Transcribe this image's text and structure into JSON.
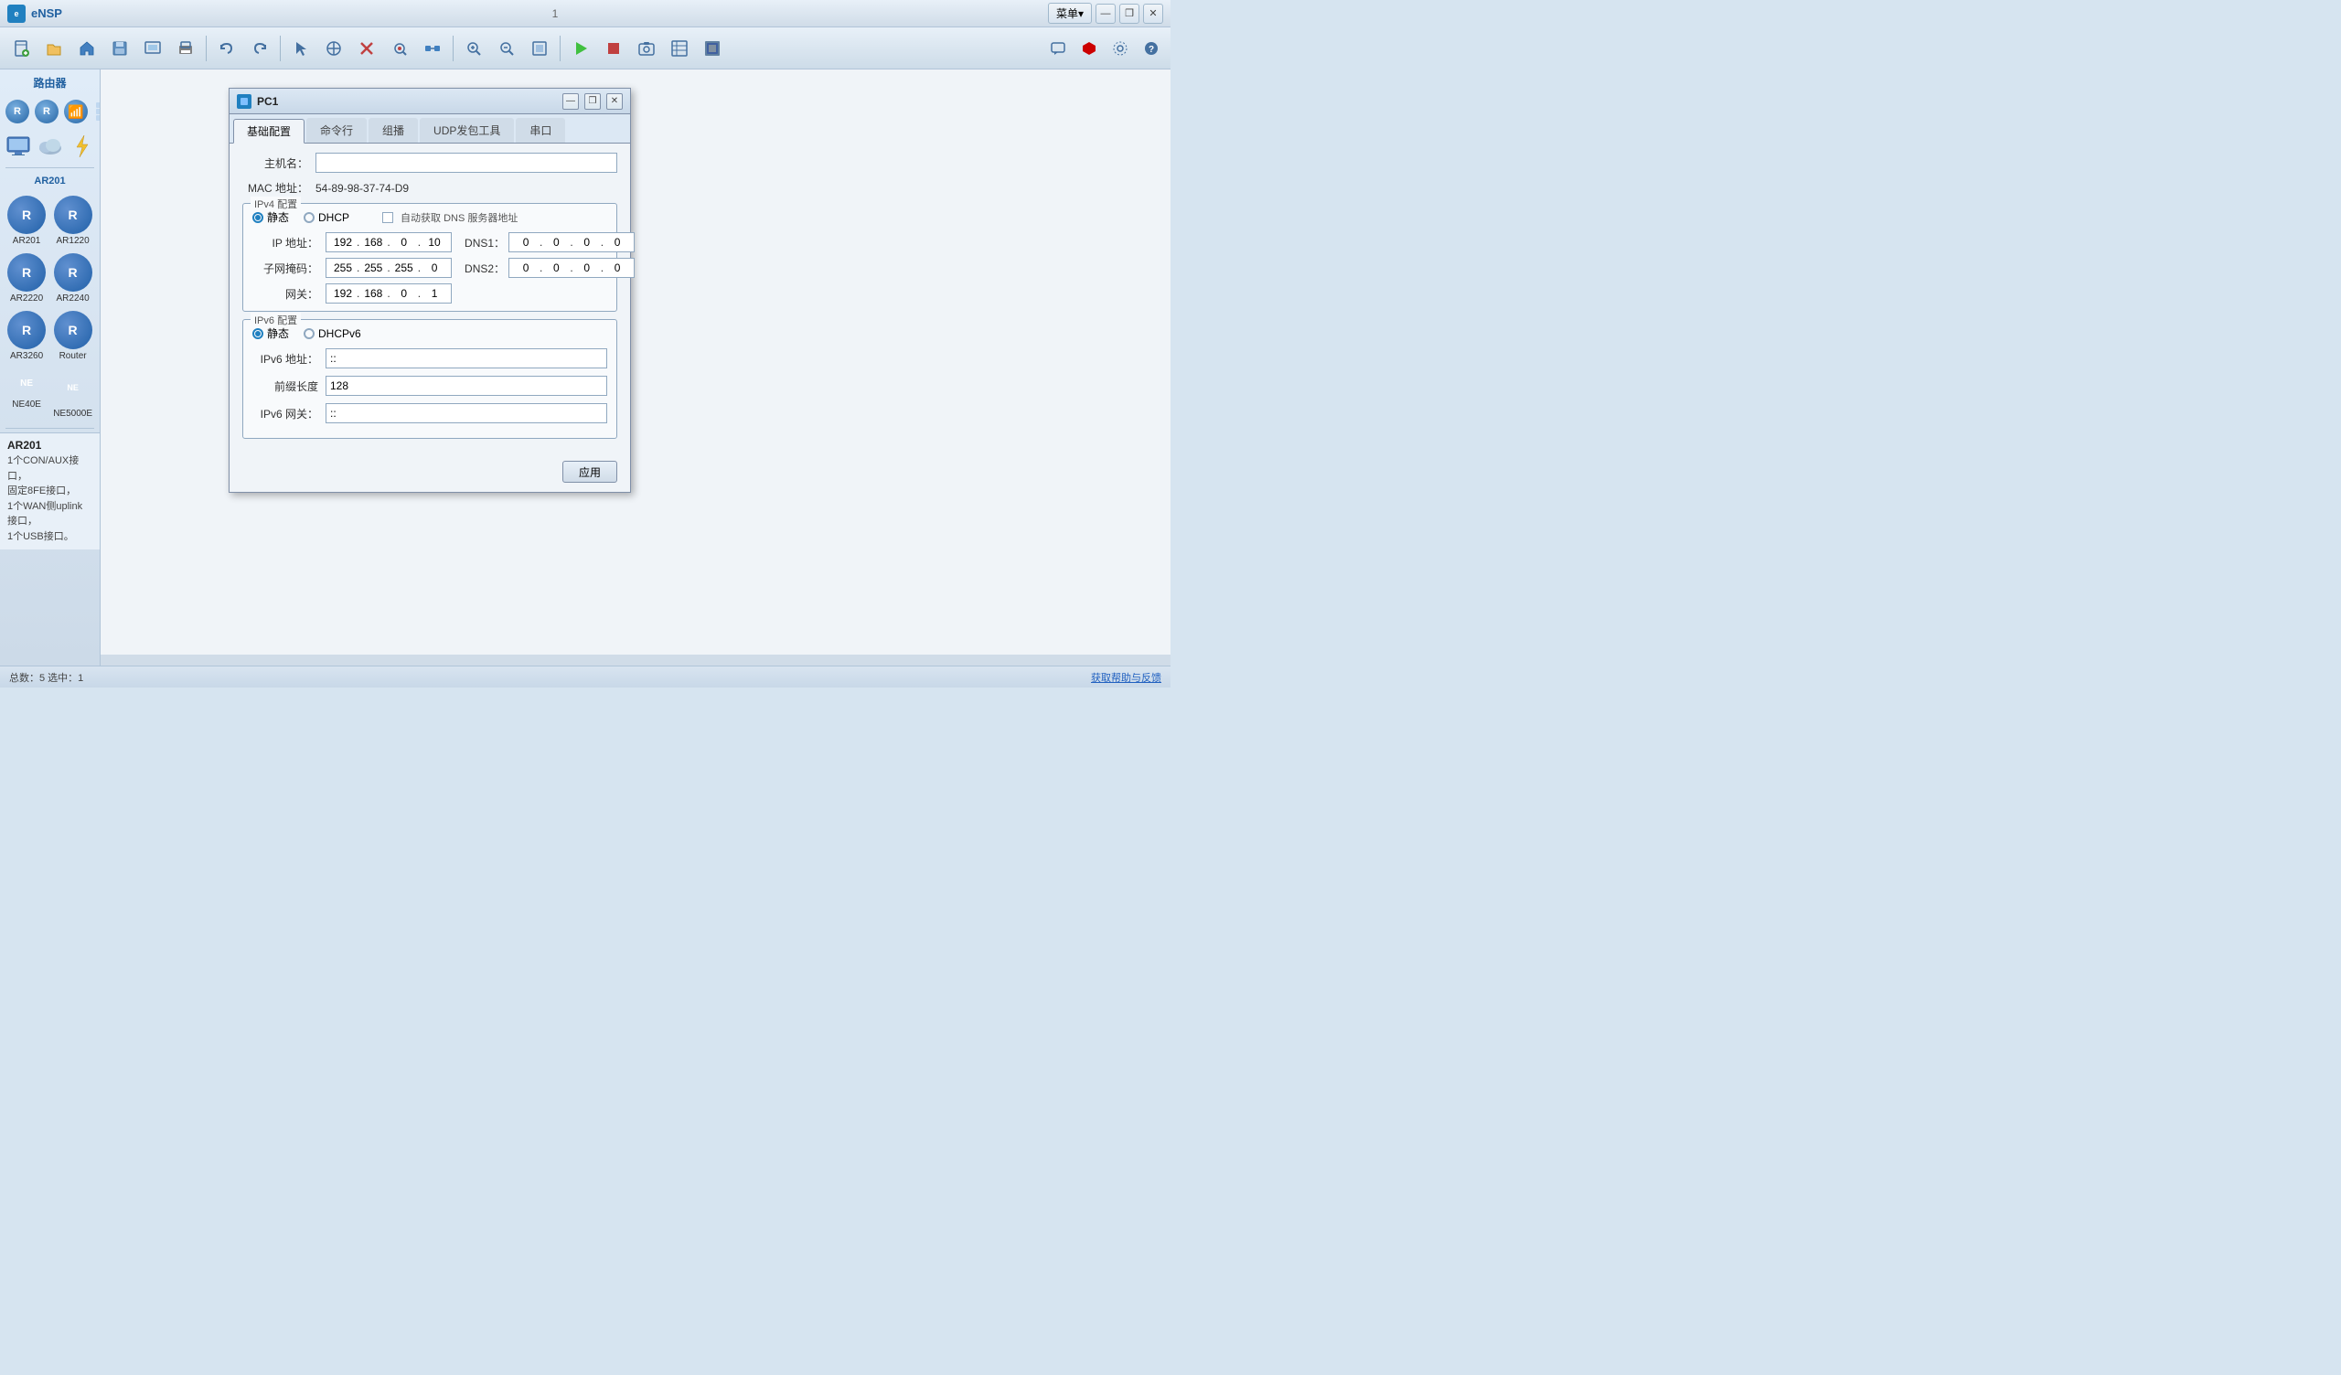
{
  "app": {
    "title": "eNSP",
    "window_number": "1",
    "menu_label": "菜单▾"
  },
  "titlebar": {
    "minimize": "—",
    "maximize": "❒",
    "close": "✕"
  },
  "toolbar": {
    "buttons": [
      {
        "name": "new",
        "icon": "📄"
      },
      {
        "name": "open",
        "icon": "📂"
      },
      {
        "name": "save-topo",
        "icon": "🏠"
      },
      {
        "name": "save",
        "icon": "💾"
      },
      {
        "name": "export",
        "icon": "🖨"
      },
      {
        "name": "print",
        "icon": "🖨"
      },
      {
        "name": "undo",
        "icon": "↩"
      },
      {
        "name": "redo",
        "icon": "↪"
      },
      {
        "name": "select",
        "icon": "↖"
      },
      {
        "name": "move",
        "icon": "✋"
      },
      {
        "name": "delete",
        "icon": "✖"
      },
      {
        "name": "capture",
        "icon": "🔍"
      },
      {
        "name": "link",
        "icon": "🔗"
      },
      {
        "name": "zoom-in",
        "icon": "🔎"
      },
      {
        "name": "zoom-out",
        "icon": "🔍"
      },
      {
        "name": "fit",
        "icon": "⊞"
      },
      {
        "name": "start-all",
        "icon": "▶"
      },
      {
        "name": "stop-all",
        "icon": "■"
      },
      {
        "name": "snapshot",
        "icon": "📷"
      },
      {
        "name": "config",
        "icon": "⊞"
      },
      {
        "name": "topology",
        "icon": "🖼"
      }
    ],
    "right_buttons": [
      {
        "name": "msg",
        "icon": "💬"
      },
      {
        "name": "huawei",
        "icon": "🔷"
      },
      {
        "name": "settings",
        "icon": "⚙"
      },
      {
        "name": "help",
        "icon": "?"
      }
    ]
  },
  "sidebar": {
    "router_section_title": "路由器",
    "top_icons": [
      {
        "name": "router-top-1",
        "type": "r"
      },
      {
        "name": "router-top-2",
        "type": "r"
      },
      {
        "name": "router-top-wifi",
        "type": "wifi"
      },
      {
        "name": "router-top-switch",
        "type": "switch"
      }
    ],
    "bottom_icons": [
      {
        "name": "monitor-icon",
        "type": "monitor"
      },
      {
        "name": "cloud-icon",
        "type": "cloud"
      },
      {
        "name": "bolt-icon",
        "type": "bolt"
      }
    ],
    "category_label": "AR201",
    "devices": [
      {
        "id": "AR201",
        "label": "AR201",
        "type": "ar"
      },
      {
        "id": "AR1220",
        "label": "AR1220",
        "type": "ar"
      },
      {
        "id": "AR2220",
        "label": "AR2220",
        "type": "ar"
      },
      {
        "id": "AR2240",
        "label": "AR2240",
        "type": "ar"
      },
      {
        "id": "AR3260",
        "label": "AR3260",
        "type": "ar"
      },
      {
        "id": "Router",
        "label": "Router",
        "type": "ar"
      },
      {
        "id": "NE40E",
        "label": "NE40E",
        "type": "ne40"
      },
      {
        "id": "NE5000E",
        "label": "NE5000E",
        "type": "ne5000"
      }
    ],
    "info_title": "AR201",
    "info_text": "1个CON/AUX接口，\n固定8FE接口，\n1个WAN侧uplink接口，\n1个USB接口。"
  },
  "dialog": {
    "title": "PC1",
    "tabs": [
      {
        "id": "basic",
        "label": "基础配置",
        "active": true
      },
      {
        "id": "cmd",
        "label": "命令行"
      },
      {
        "id": "multicast",
        "label": "组播"
      },
      {
        "id": "udp",
        "label": "UDP发包工具"
      },
      {
        "id": "serial",
        "label": "串口"
      }
    ],
    "hostname_label": "主机名：",
    "hostname_value": "",
    "mac_label": "MAC 地址：",
    "mac_value": "54-89-98-37-74-D9",
    "ipv4_section_label": "IPv4 配置",
    "ipv4_radio_static": "静态",
    "ipv4_radio_dhcp": "DHCP",
    "auto_dns_label": "自动获取 DNS 服务器地址",
    "ip_label": "IP 地址：",
    "ip_parts": [
      "192",
      "168",
      "0",
      "10"
    ],
    "dns1_label": "DNS1：",
    "dns1_parts": [
      "0",
      "0",
      "0",
      "0"
    ],
    "subnet_label": "子网掩码：",
    "subnet_parts": [
      "255",
      "255",
      "255",
      "0"
    ],
    "dns2_label": "DNS2：",
    "dns2_parts": [
      "0",
      "0",
      "0",
      "0"
    ],
    "gateway_label": "网关：",
    "gateway_parts": [
      "192",
      "168",
      "0",
      "1"
    ],
    "ipv6_section_label": "IPv6 配置",
    "ipv6_radio_static": "静态",
    "ipv6_radio_dhcpv6": "DHCPv6",
    "ipv6_addr_label": "IPv6 地址：",
    "ipv6_addr_value": "::",
    "prefix_label": "前缀长度",
    "prefix_value": "128",
    "ipv6_gw_label": "IPv6 网关：",
    "ipv6_gw_value": "::",
    "apply_label": "应用"
  },
  "status_bar": {
    "left": "总数：5  选中：1",
    "right": "获取帮助与反馈"
  }
}
